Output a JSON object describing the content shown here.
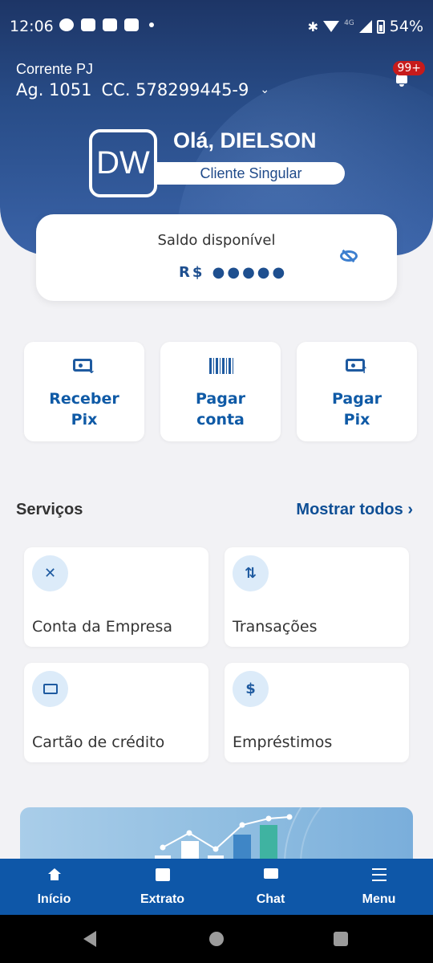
{
  "status_bar": {
    "time": "12:06",
    "network": "4G",
    "battery": "54%"
  },
  "account": {
    "type": "Corrente PJ",
    "agency": "Ag. 1051",
    "number": "CC. 578299445-9",
    "notifications_badge": "99+"
  },
  "user": {
    "initials": "DW",
    "greeting": "Olá, DIELSON",
    "tier": "Cliente Singular"
  },
  "balance": {
    "label": "Saldo disponível",
    "value": "R$ ●●●●●"
  },
  "quick_actions": [
    {
      "label": "Receber\nPix",
      "icon": "receive-pix-icon"
    },
    {
      "label": "Pagar\nconta",
      "icon": "barcode-icon"
    },
    {
      "label": "Pagar\nPix",
      "icon": "pay-pix-icon"
    }
  ],
  "services": {
    "title": "Serviços",
    "show_all": "Mostrar todos",
    "items": [
      {
        "label": "Conta da Empresa",
        "icon": "caixa-logo-icon"
      },
      {
        "label": "Transações",
        "icon": "transfer-arrows-icon"
      },
      {
        "label": "Cartão de crédito",
        "icon": "credit-card-icon"
      },
      {
        "label": "Empréstimos",
        "icon": "loan-hand-icon"
      }
    ]
  },
  "bottom_nav": [
    {
      "label": "Início",
      "icon": "home-icon"
    },
    {
      "label": "Extrato",
      "icon": "statement-icon"
    },
    {
      "label": "Chat",
      "icon": "chat-icon"
    },
    {
      "label": "Menu",
      "icon": "menu-icon"
    }
  ],
  "colors": {
    "header": "#284c87",
    "accent": "#0f5aa6",
    "nav": "#0e57a8",
    "badge": "#c71b1b"
  }
}
